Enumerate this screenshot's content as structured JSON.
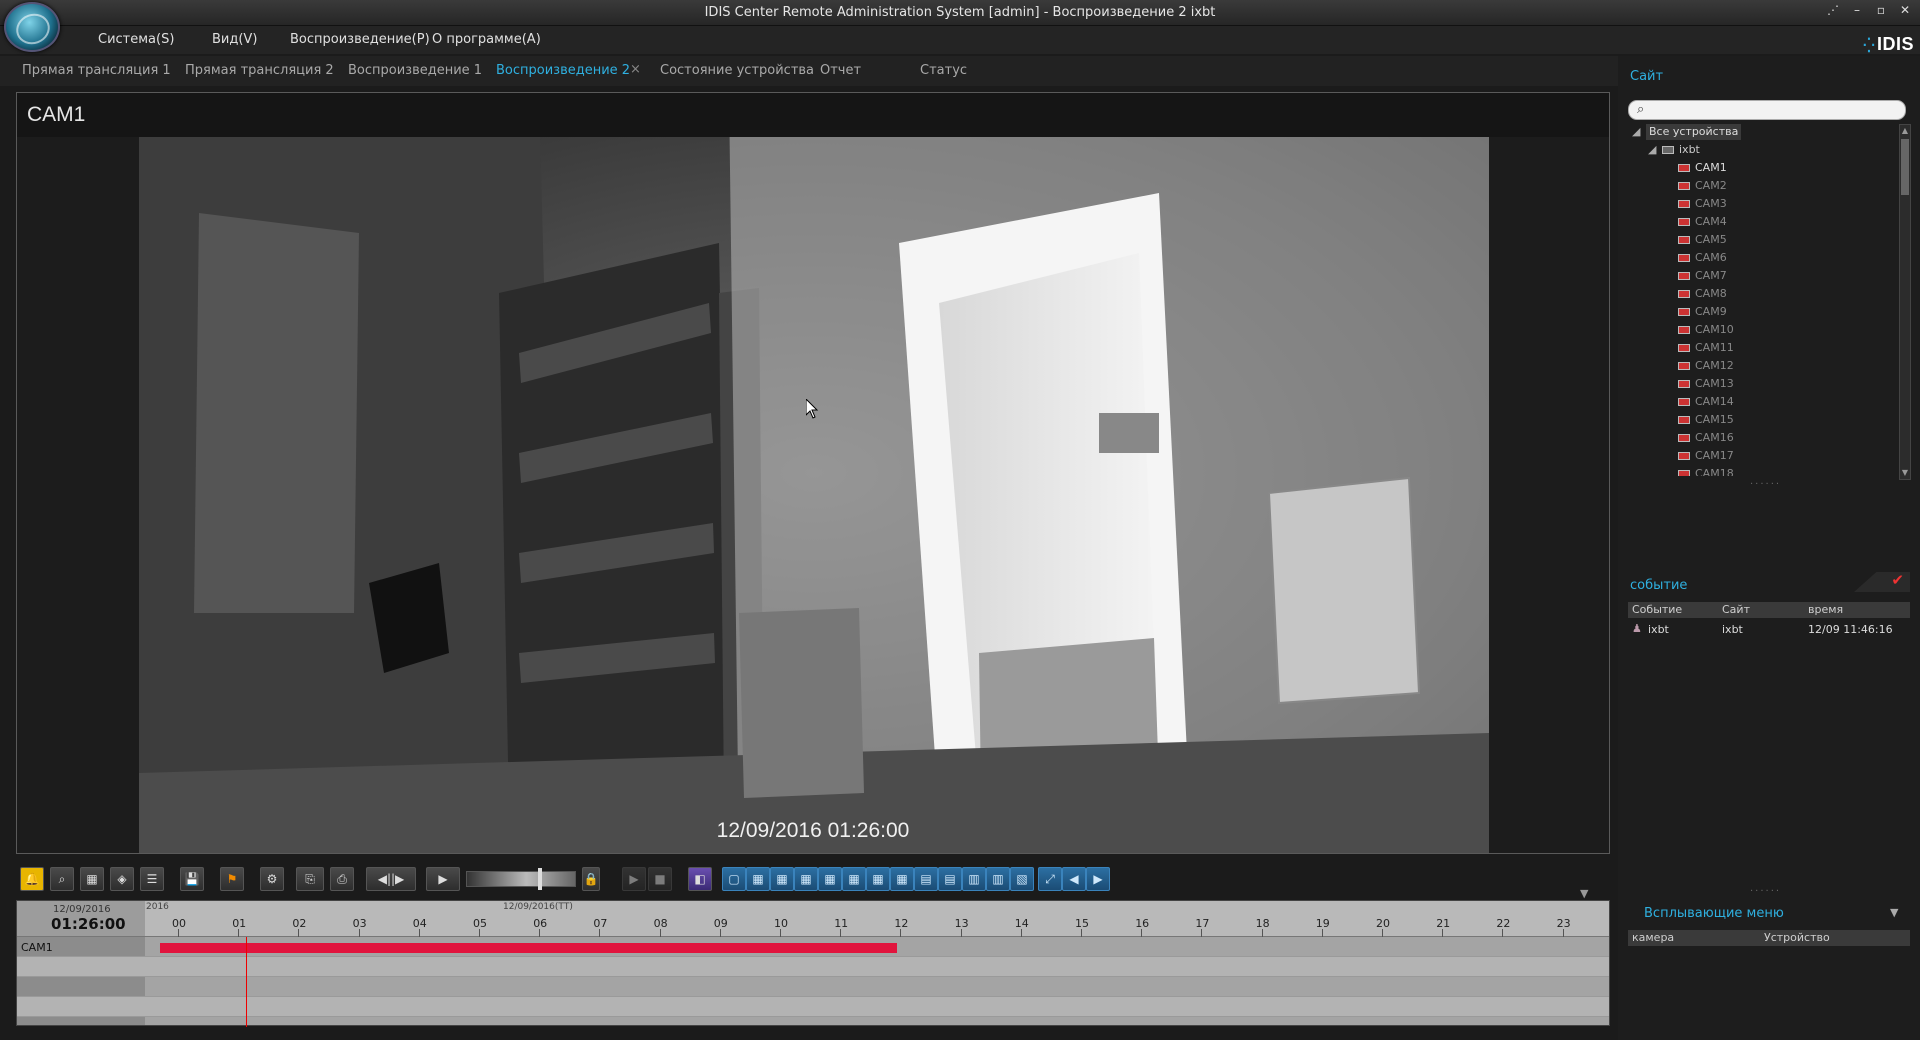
{
  "window": {
    "title": "IDIS Center Remote Administration System [admin] - Воспроизведение 2  ixbt",
    "controls": {
      "minimize": "–",
      "maximize": "▫",
      "close": "✕"
    }
  },
  "brand": "IDIS",
  "menu": [
    "Система(S)",
    "Вид(V)",
    "Воспроизведение(P)",
    "О программе(A)"
  ],
  "tabs": [
    {
      "label": "Прямая трансляция 1",
      "active": false
    },
    {
      "label": "Прямая трансляция 2",
      "active": false
    },
    {
      "label": "Воспроизведение 1",
      "active": false
    },
    {
      "label": "Воспроизведение 2",
      "active": true
    },
    {
      "label": "Состояние устройства",
      "active": false
    },
    {
      "label": "Отчет",
      "active": false
    },
    {
      "label": "Статус",
      "active": false
    }
  ],
  "tab_close": "×",
  "video": {
    "camera_title": "CAM1",
    "timestamp": "12/09/2016 01:26:00"
  },
  "toolbar": {
    "icons": [
      "alarm-bell-icon",
      "search-icon",
      "calendar-icon",
      "snapshot-icon",
      "layout-list-icon",
      "save-icon",
      "bookmark-flag-icon",
      "settings-icon",
      "export-icon",
      "print-icon"
    ],
    "play_glyph": "▶",
    "frame_back_glyph": "◀|",
    "frame_fwd_glyph": "|▶",
    "lock_glyph": "🔒",
    "stop_glyph": "■"
  },
  "timeline": {
    "date": "12/09/2016",
    "time": "01:26:00",
    "small_date_left": "2016",
    "small_date_mid": "12/09/2016(ТТ)",
    "hours": [
      "00",
      "01",
      "02",
      "03",
      "04",
      "05",
      "06",
      "07",
      "08",
      "09",
      "10",
      "11",
      "12",
      "13",
      "14",
      "15",
      "16",
      "17",
      "18",
      "19",
      "20",
      "21",
      "22",
      "23"
    ],
    "rows": [
      "CAM1",
      "",
      "",
      ""
    ],
    "recording": {
      "camera": "CAM1",
      "start_hour": 0,
      "end_hour": 12.5
    },
    "playhead_hour": 1.43
  },
  "site_panel": {
    "title": "Сайт",
    "search_icon": "⌕",
    "root": "Все устройства",
    "device": "ixbt",
    "cameras": [
      "CAM1",
      "CAM2",
      "CAM3",
      "CAM4",
      "CAM5",
      "CAM6",
      "CAM7",
      "CAM8",
      "CAM9",
      "CAM10",
      "CAM11",
      "CAM12",
      "CAM13",
      "CAM14",
      "CAM15",
      "CAM16",
      "CAM17",
      "CAM18"
    ],
    "selected_camera": "CAM1"
  },
  "event_panel": {
    "title": "событие",
    "columns": [
      "Событие",
      "Сайт",
      "время"
    ],
    "rows": [
      {
        "event": "ixbt",
        "site": "ixbt",
        "time": "12/09 11:46:16"
      }
    ]
  },
  "popup_menu": {
    "title": "Всплывающие меню",
    "columns": [
      "камера",
      "Устройство"
    ]
  },
  "colors": {
    "accent": "#2fb0e0",
    "recording": "#e1143d",
    "playhead": "#ee0000"
  }
}
